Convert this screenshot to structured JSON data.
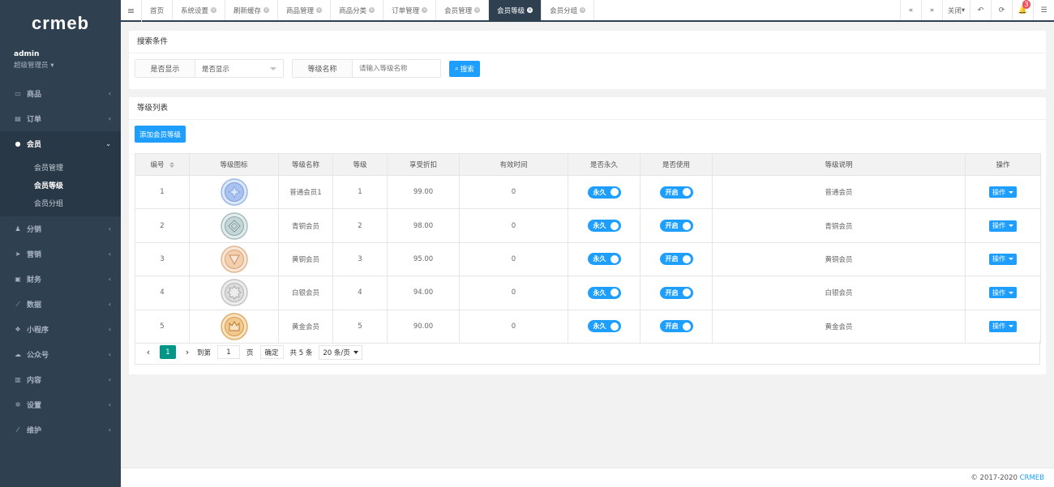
{
  "sidebar": {
    "logo": "crmeb",
    "user": {
      "name": "admin",
      "role": "超级管理员"
    },
    "items": [
      {
        "label": "商品",
        "icon": "laptop-icon"
      },
      {
        "label": "订单",
        "icon": "document-icon"
      },
      {
        "label": "会员",
        "icon": "user-icon",
        "active": true
      },
      {
        "label": "分销",
        "icon": "group-icon"
      },
      {
        "label": "营销",
        "icon": "paper-plane-icon"
      },
      {
        "label": "财务",
        "icon": "money-icon"
      },
      {
        "label": "数据",
        "icon": "chart-icon"
      },
      {
        "label": "小程序",
        "icon": "cubes-icon"
      },
      {
        "label": "公众号",
        "icon": "wechat-icon"
      },
      {
        "label": "内容",
        "icon": "book-icon"
      },
      {
        "label": "设置",
        "icon": "gear-icon"
      },
      {
        "label": "维护",
        "icon": "magic-icon"
      }
    ],
    "submenu": [
      "会员管理",
      "会员等级",
      "会员分组"
    ]
  },
  "tabs": [
    {
      "label": "首页",
      "closable": false
    },
    {
      "label": "系统设置",
      "closable": true
    },
    {
      "label": "刷新缓存",
      "closable": true
    },
    {
      "label": "商品管理",
      "closable": true
    },
    {
      "label": "商品分类",
      "closable": true
    },
    {
      "label": "订单管理",
      "closable": true
    },
    {
      "label": "会员管理",
      "closable": true
    },
    {
      "label": "会员等级",
      "closable": true,
      "active": true
    },
    {
      "label": "会员分组",
      "closable": true
    }
  ],
  "toolbar": {
    "close_label": "关闭",
    "notification_count": "3"
  },
  "search": {
    "title": "搜索条件",
    "show_label": "是否显示",
    "show_value": "是否显示",
    "name_label": "等级名称",
    "name_placeholder": "请输入等级名称",
    "search_button": "搜索"
  },
  "list": {
    "title": "等级列表",
    "add_button": "添加会员等级",
    "columns": [
      "编号",
      "等级图标",
      "等级名称",
      "等级",
      "享受折扣",
      "有效时间",
      "是否永久",
      "是否使用",
      "等级说明",
      "操作"
    ],
    "rows": [
      {
        "id": "1",
        "name": "普通会员1",
        "grade": "1",
        "discount": "99.00",
        "valid": "0",
        "forever": "永久",
        "use": "开启",
        "desc": "普通会员",
        "op": "操作",
        "medal": "blue"
      },
      {
        "id": "2",
        "name": "青铜会员",
        "grade": "2",
        "discount": "98.00",
        "valid": "0",
        "forever": "永久",
        "use": "开启",
        "desc": "青铜会员",
        "op": "操作",
        "medal": "teal"
      },
      {
        "id": "3",
        "name": "黄铜会员",
        "grade": "3",
        "discount": "95.00",
        "valid": "0",
        "forever": "永久",
        "use": "开启",
        "desc": "黄铜会员",
        "op": "操作",
        "medal": "orange"
      },
      {
        "id": "4",
        "name": "白银会员",
        "grade": "4",
        "discount": "94.00",
        "valid": "0",
        "forever": "永久",
        "use": "开启",
        "desc": "白银会员",
        "op": "操作",
        "medal": "silver"
      },
      {
        "id": "5",
        "name": "黄金会员",
        "grade": "5",
        "discount": "90.00",
        "valid": "0",
        "forever": "永久",
        "use": "开启",
        "desc": "黄金会员",
        "op": "操作",
        "medal": "gold"
      }
    ]
  },
  "pager": {
    "current": "1",
    "goto_label": "到第",
    "page_input": "1",
    "page_unit": "页",
    "confirm": "确定",
    "total": "共 5 条",
    "limit": "20 条/页"
  },
  "footer": {
    "copyright": "© 2017-2020",
    "brand": "CRMEB"
  },
  "colors": {
    "sidebar": "#2f4050",
    "primary": "#1e9fff",
    "pager_active": "#009688",
    "badge": "#ed5565"
  }
}
